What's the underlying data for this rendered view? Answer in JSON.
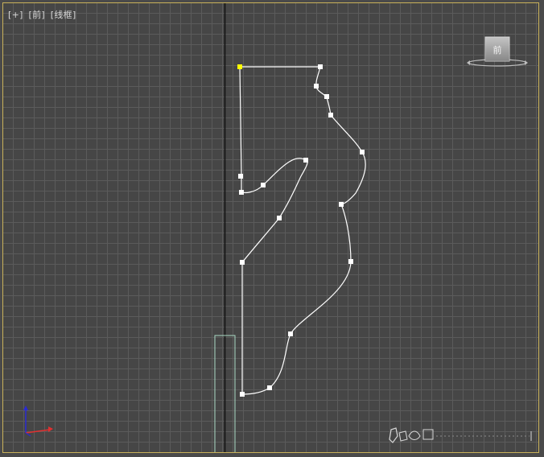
{
  "viewport": {
    "label_plus": "[+]",
    "label_view": "[前]",
    "label_mode": "[线框]",
    "active_border_color": "#c9b15a",
    "grid_line_color": "#5b5b5b",
    "background_color": "#464646",
    "spline_color": "#ffffff",
    "first_vertex_color": "#ffff00",
    "box_outline_color": "#a9d9c4"
  },
  "viewcube": {
    "face_label": "前"
  },
  "axis_tripod": {
    "x_color": "#e03030",
    "y_color": "#2a2ad0",
    "z_color": "#2a2ad0"
  }
}
